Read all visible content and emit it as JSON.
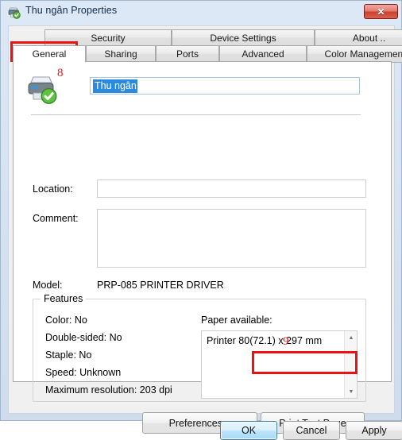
{
  "window": {
    "title": "Thu ngân Properties",
    "title_icon": "printer-ready-icon",
    "close_label": "✕"
  },
  "tabs": {
    "row1": [
      {
        "label": "Security",
        "selected": false
      },
      {
        "label": "Device Settings",
        "selected": false
      },
      {
        "label": "About ..",
        "selected": false
      }
    ],
    "row2": [
      {
        "label": "General",
        "selected": true
      },
      {
        "label": "Sharing",
        "selected": false
      },
      {
        "label": "Ports",
        "selected": false
      },
      {
        "label": "Advanced",
        "selected": false
      },
      {
        "label": "Color Management",
        "selected": false
      }
    ]
  },
  "general": {
    "printer_icon": "printer-ready-icon",
    "name_value": "Thu ngân",
    "name_selected": true,
    "location_label": "Location:",
    "location_value": "",
    "location_placeholder": "",
    "comment_label": "Comment:",
    "comment_value": "",
    "comment_placeholder": "",
    "model_label": "Model:",
    "model_value": "PRP-085 PRINTER DRIVER"
  },
  "features": {
    "legend": "Features",
    "rows": [
      "Color: No",
      "Double-sided: No",
      "Staple: No",
      "Speed: Unknown",
      "Maximum resolution: 203 dpi"
    ],
    "paper_label": "Paper available:",
    "paper_items": [
      "Printer 80(72.1) x 297 mm"
    ],
    "scroll_up_icon": "▲",
    "scroll_down_icon": "▼"
  },
  "buttons": {
    "preferences": "Preferences...",
    "print_test_page": "Print Test Page",
    "ok": "OK",
    "cancel": "Cancel",
    "apply": "Apply"
  },
  "annotations": {
    "step_8": "8",
    "step_9": "9",
    "color": "#ee1111"
  }
}
